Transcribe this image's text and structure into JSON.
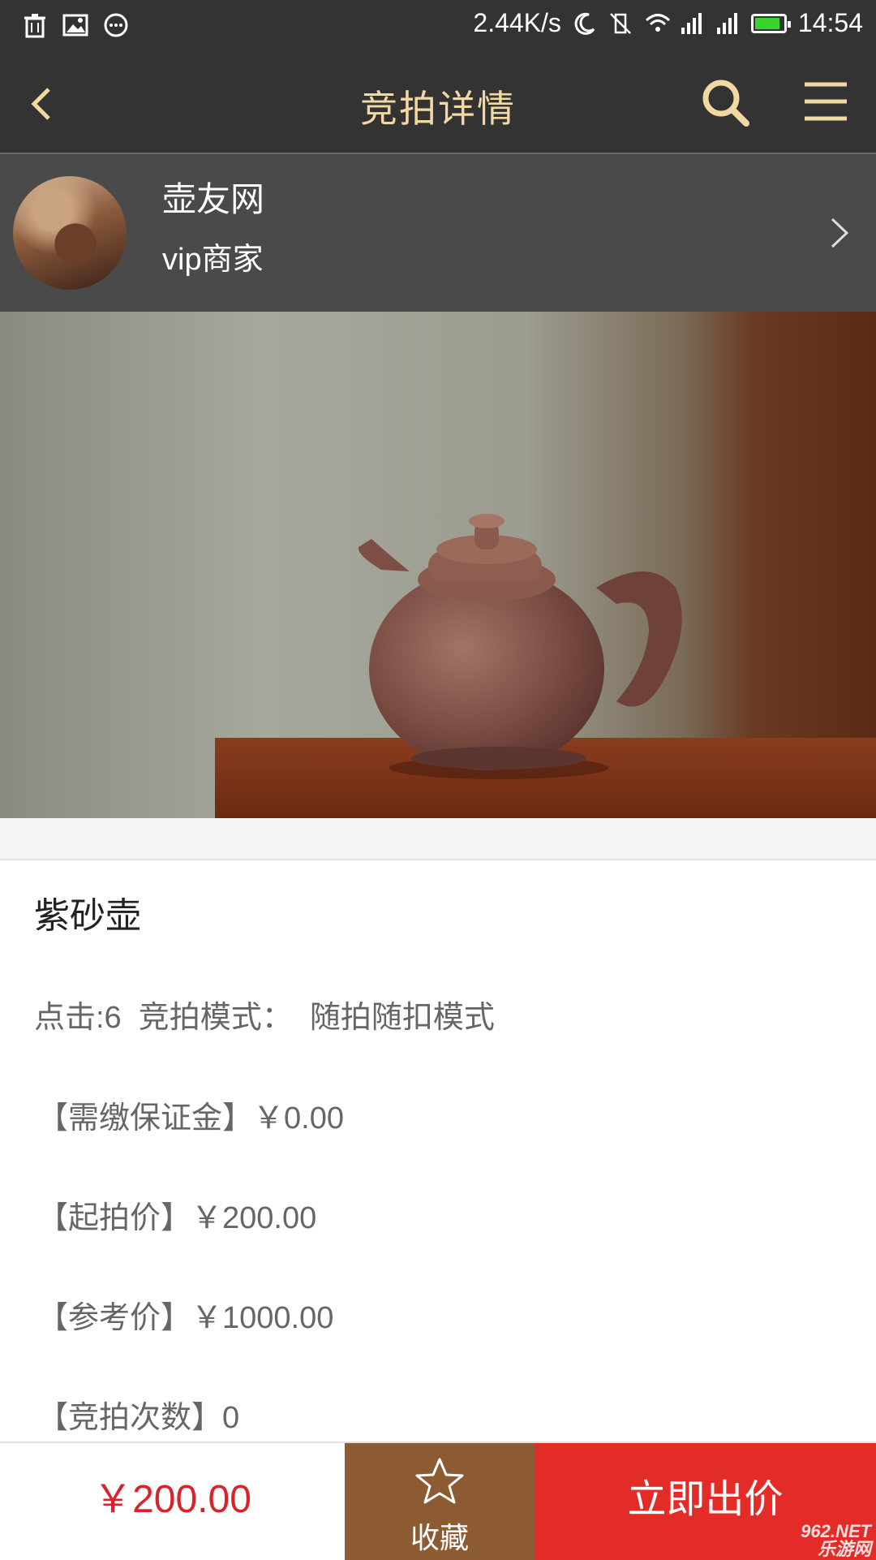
{
  "status_bar": {
    "network_speed": "2.44K/s",
    "time": "14:54",
    "battery_color": "#39d52f"
  },
  "header": {
    "title": "竞拍详情"
  },
  "shop": {
    "name": "壶友网",
    "tag": "vip商家"
  },
  "item": {
    "title": "紫砂壶",
    "clicks_line": "点击:6  竞拍模式：  随拍随扣模式",
    "deposit_line": "【需缴保证金】￥0.00",
    "start_price_line": "【起拍价】￥200.00",
    "reference_price_line": "【参考价】￥1000.00",
    "bid_count_line": "【竞拍次数】0"
  },
  "bottom_bar": {
    "price": "￥200.00",
    "favorite_label": "收藏",
    "bid_button_label": "立即出价",
    "price_color": "#d8232a",
    "favorite_bg": "#8c5b32",
    "bid_bg": "#e32b28"
  },
  "watermark": {
    "text": "962.NET",
    "subtext": "乐游网"
  }
}
